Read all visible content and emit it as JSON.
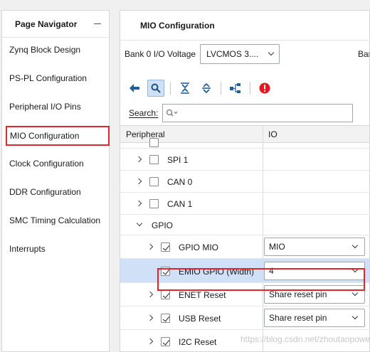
{
  "navigator": {
    "title": "Page Navigator",
    "items": [
      {
        "label": "Zynq Block Design"
      },
      {
        "label": "PS-PL Configuration"
      },
      {
        "label": "Peripheral I/O Pins"
      },
      {
        "label": "MIO Configuration",
        "active": true
      },
      {
        "label": "Clock Configuration"
      },
      {
        "label": "DDR Configuration"
      },
      {
        "label": "SMC Timing Calculation"
      },
      {
        "label": "Interrupts"
      }
    ]
  },
  "main": {
    "title": "MIO Configuration",
    "bank0": {
      "label": "Bank 0 I/O Voltage",
      "value": "LVCMOS 3...."
    },
    "bank1_label_partial": "Ban",
    "toolbar": {
      "icons": [
        "back-arrow-icon",
        "search-icon",
        "collapse-all-icon",
        "expand-all-icon",
        "hierarchy-icon",
        "error-icon"
      ]
    },
    "search": {
      "label": "Search:",
      "placeholder": "Q-"
    },
    "columns": {
      "peripheral": "Peripheral",
      "io": "IO"
    },
    "rows": [
      {
        "label": "SPI 1",
        "checked": false
      },
      {
        "label": "CAN 0",
        "checked": false
      },
      {
        "label": "CAN 1",
        "checked": false
      },
      {
        "label": "GPIO"
      },
      {
        "label": "GPIO MIO",
        "checked": true,
        "io": "MIO"
      },
      {
        "label": "EMIO GPIO (Width)",
        "checked": true,
        "io": "4"
      },
      {
        "label": "ENET Reset",
        "checked": true,
        "io": "Share reset pin"
      },
      {
        "label": "USB Reset",
        "checked": true,
        "io": "Share reset pin"
      },
      {
        "label": "I2C Reset",
        "checked": true
      }
    ]
  },
  "watermark": "https://blog.csdn.net/zhoutaopower",
  "colors": {
    "highlight": "#cfe0f7",
    "annotation_red": "#e3242b",
    "error_red": "#e8141e",
    "icon_blue": "#1f5f9e"
  }
}
